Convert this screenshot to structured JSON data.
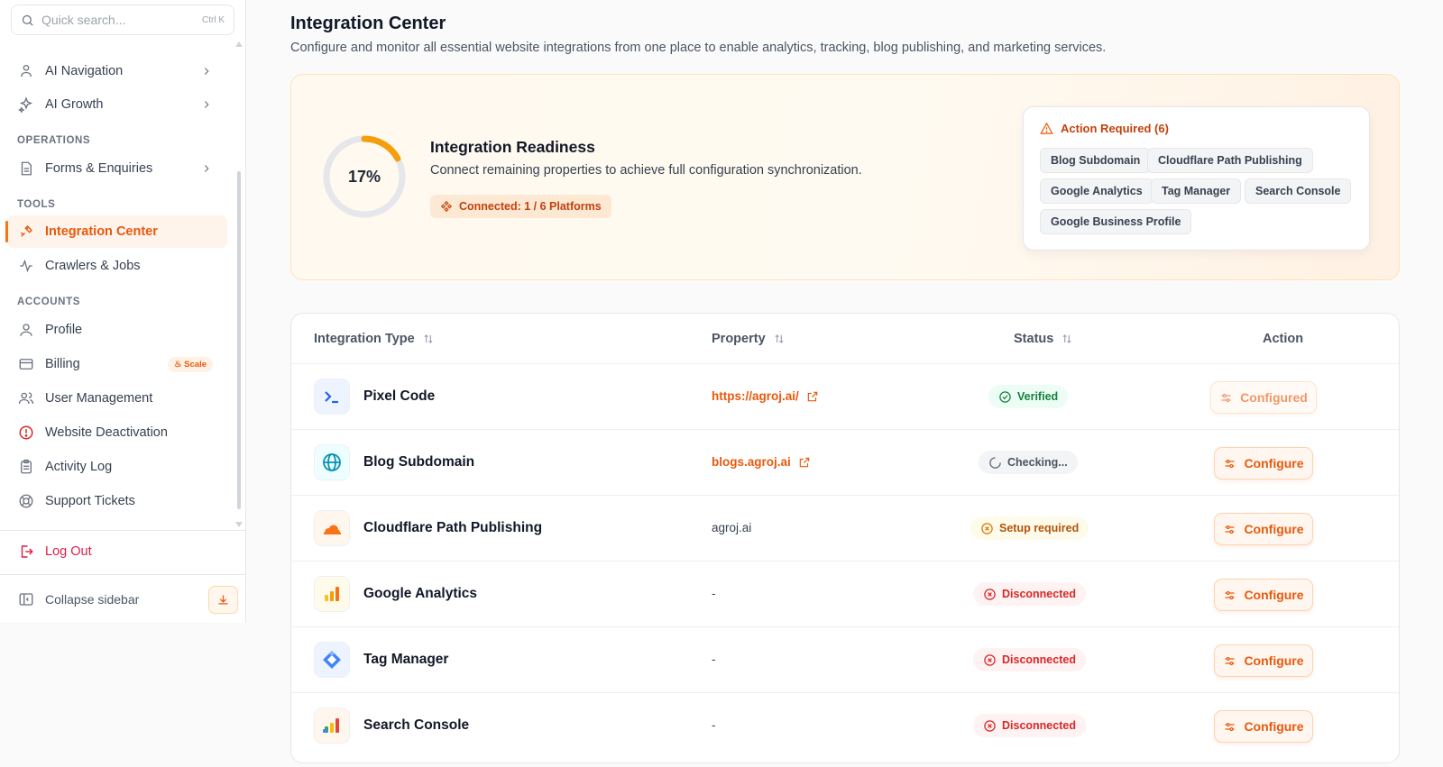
{
  "sidebar": {
    "search": {
      "placeholder": "Quick search...",
      "shortcut": "Ctrl K"
    },
    "items": {
      "ai_navigation": "AI Navigation",
      "ai_growth": "AI Growth",
      "forms": "Forms & Enquiries",
      "integration_center": "Integration Center",
      "crawlers": "Crawlers & Jobs",
      "profile": "Profile",
      "billing": "Billing",
      "billing_badge": "Scale",
      "user_management": "User Management",
      "website_deactivation": "Website Deactivation",
      "activity_log": "Activity Log",
      "support_tickets": "Support Tickets",
      "logout": "Log Out",
      "collapse": "Collapse sidebar"
    },
    "sections": {
      "operations": "OPERATIONS",
      "tools": "TOOLS",
      "accounts": "ACCOUNTS"
    }
  },
  "page": {
    "title": "Integration Center",
    "subtitle": "Configure and monitor all essential website integrations from one place to enable analytics, tracking, blog publishing, and marketing services."
  },
  "readiness": {
    "percent_label": "17%",
    "percent": 0.17,
    "title": "Integration Readiness",
    "description": "Connect remaining properties to achieve full configuration synchronization.",
    "connected": "Connected: 1 / 6 Platforms",
    "action_required": "Action Required (6)",
    "chips": [
      "Blog Subdomain",
      "Cloudflare Path Publishing",
      "Google Analytics",
      "Tag Manager",
      "Search Console",
      "Google Business Profile"
    ]
  },
  "table": {
    "headers": {
      "type": "Integration Type",
      "property": "Property",
      "status": "Status",
      "action": "Action"
    },
    "rows": [
      {
        "name": "Pixel Code",
        "property": "https://agroj.ai/",
        "status": "Verified",
        "action": "Configured",
        "icon": "terminal-icon"
      },
      {
        "name": "Blog Subdomain",
        "property": "blogs.agroj.ai",
        "status": "Checking...",
        "action": "Configure",
        "icon": "globe-icon"
      },
      {
        "name": "Cloudflare Path Publishing",
        "property": "agroj.ai",
        "status": "Setup required",
        "action": "Configure",
        "icon": "cloudflare-icon"
      },
      {
        "name": "Google Analytics",
        "property": "-",
        "status": "Disconnected",
        "action": "Configure",
        "icon": "analytics-icon"
      },
      {
        "name": "Tag Manager",
        "property": "-",
        "status": "Disconnected",
        "action": "Configure",
        "icon": "tag-manager-icon"
      },
      {
        "name": "Search Console",
        "property": "-",
        "status": "Disconnected",
        "action": "Configure",
        "icon": "search-console-icon"
      }
    ]
  },
  "colors": {
    "accent": "#ea580c",
    "verified": "#15803d",
    "danger": "#dc2626",
    "warning": "#b45309"
  }
}
